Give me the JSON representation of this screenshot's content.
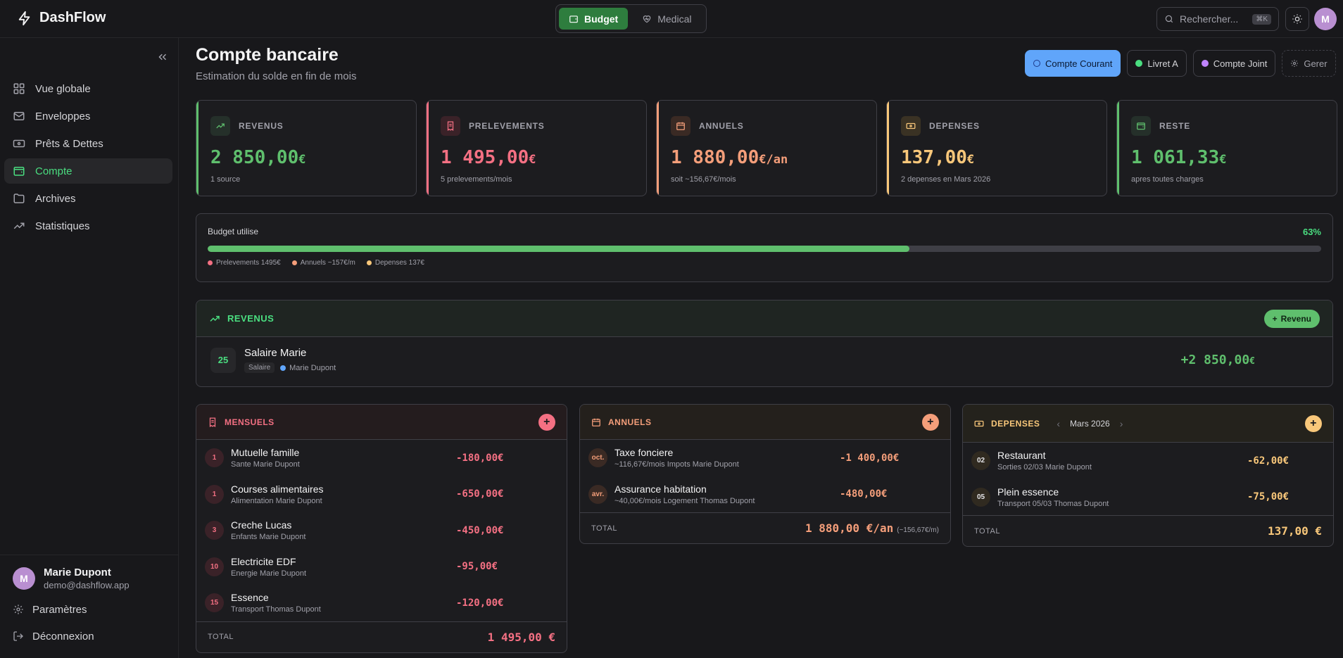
{
  "app": {
    "name": "DashFlow"
  },
  "modes": [
    {
      "label": "Budget",
      "active": true
    },
    {
      "label": "Medical",
      "active": false
    }
  ],
  "search": {
    "placeholder": "Rechercher...",
    "shortcut": "⌘K"
  },
  "user": {
    "initial": "M",
    "name": "Marie Dupont",
    "email": "demo@dashflow.app"
  },
  "sidebar": {
    "items": [
      {
        "label": "Vue globale",
        "icon": "grid-icon"
      },
      {
        "label": "Enveloppes",
        "icon": "mail-icon"
      },
      {
        "label": "Prêts & Dettes",
        "icon": "banknote-icon"
      },
      {
        "label": "Compte",
        "icon": "wallet-icon",
        "active": true
      },
      {
        "label": "Archives",
        "icon": "folder-icon"
      },
      {
        "label": "Statistiques",
        "icon": "trend-icon"
      }
    ],
    "settings": "Paramètres",
    "logout": "Déconnexion"
  },
  "page": {
    "title": "Compte bancaire",
    "subtitle": "Estimation du solde en fin de mois"
  },
  "accounts": [
    {
      "label": "Compte Courant",
      "active": true
    },
    {
      "label": "Livret A",
      "color": "#4ade80"
    },
    {
      "label": "Compte Joint",
      "color": "#c084fc"
    },
    {
      "label": "Gerer"
    }
  ],
  "stats": [
    {
      "label": "REVENUS",
      "value": "2 850,00",
      "unit": "€",
      "note": "1 source",
      "color": "#5fbf6d"
    },
    {
      "label": "PRELEVEMENTS",
      "value": "1 495,00",
      "unit": "€",
      "note": "5 prelevements/mois",
      "color": "#f47083"
    },
    {
      "label": "ANNUELS",
      "value": "1 880,00",
      "unit": "€/an",
      "note": "soit ~156,67€/mois",
      "color": "#f49e7a"
    },
    {
      "label": "DEPENSES",
      "value": "137,00",
      "unit": "€",
      "note": "2 depenses en Mars 2026",
      "color": "#f8c77a"
    },
    {
      "label": "RESTE",
      "value": "1 061,33",
      "unit": "€",
      "note": "apres toutes charges",
      "color": "#5fbf6d"
    }
  ],
  "budget": {
    "label": "Budget utilise",
    "percent_text": "63%",
    "percent": 63,
    "legend": [
      {
        "label": "Prelevements 1495€",
        "color": "#f47083"
      },
      {
        "label": "Annuels ~157€/m",
        "color": "#f49e7a"
      },
      {
        "label": "Depenses 137€",
        "color": "#f8c77a"
      }
    ]
  },
  "revenus": {
    "title": "REVENUS",
    "add_label": "Revenu",
    "items": [
      {
        "day": "25",
        "title": "Salaire Marie",
        "tag": "Salaire",
        "owner": "Marie Dupont",
        "amount": "+2 850,00",
        "unit": "€"
      }
    ]
  },
  "mensuels": {
    "title": "MENSUELS",
    "items": [
      {
        "num": "1",
        "title": "Mutuelle famille",
        "meta": "Sante  Marie Dupont",
        "amount": "-180,00€"
      },
      {
        "num": "1",
        "title": "Courses alimentaires",
        "meta": "Alimentation  Marie Dupont",
        "amount": "-650,00€"
      },
      {
        "num": "3",
        "title": "Creche Lucas",
        "meta": "Enfants  Marie Dupont",
        "amount": "-450,00€"
      },
      {
        "num": "10",
        "title": "Electricite EDF",
        "meta": "Energie  Marie Dupont",
        "amount": "-95,00€"
      },
      {
        "num": "15",
        "title": "Essence",
        "meta": "Transport  Thomas Dupont",
        "amount": "-120,00€"
      }
    ],
    "total_label": "TOTAL",
    "total": "1 495,00 €"
  },
  "annuels": {
    "title": "ANNUELS",
    "items": [
      {
        "num": "oct.",
        "title": "Taxe fonciere",
        "meta": "~116,67€/mois  Impots  Marie Dupont",
        "amount": "-1 400,00€"
      },
      {
        "num": "avr.",
        "title": "Assurance habitation",
        "meta": "~40,00€/mois  Logement  Thomas Dupont",
        "amount": "-480,00€"
      }
    ],
    "total_label": "TOTAL",
    "total": "1 880,00 €/an",
    "total_sub": "(~156,67€/m)"
  },
  "depenses": {
    "title": "DEPENSES",
    "month": "Mars 2026",
    "items": [
      {
        "num": "02",
        "title": "Restaurant",
        "meta": "Sorties  02/03  Marie Dupont",
        "amount": "-62,00€"
      },
      {
        "num": "05",
        "title": "Plein essence",
        "meta": "Transport  05/03  Thomas Dupont",
        "amount": "-75,00€"
      }
    ],
    "total_label": "TOTAL",
    "total": "137,00 €"
  }
}
